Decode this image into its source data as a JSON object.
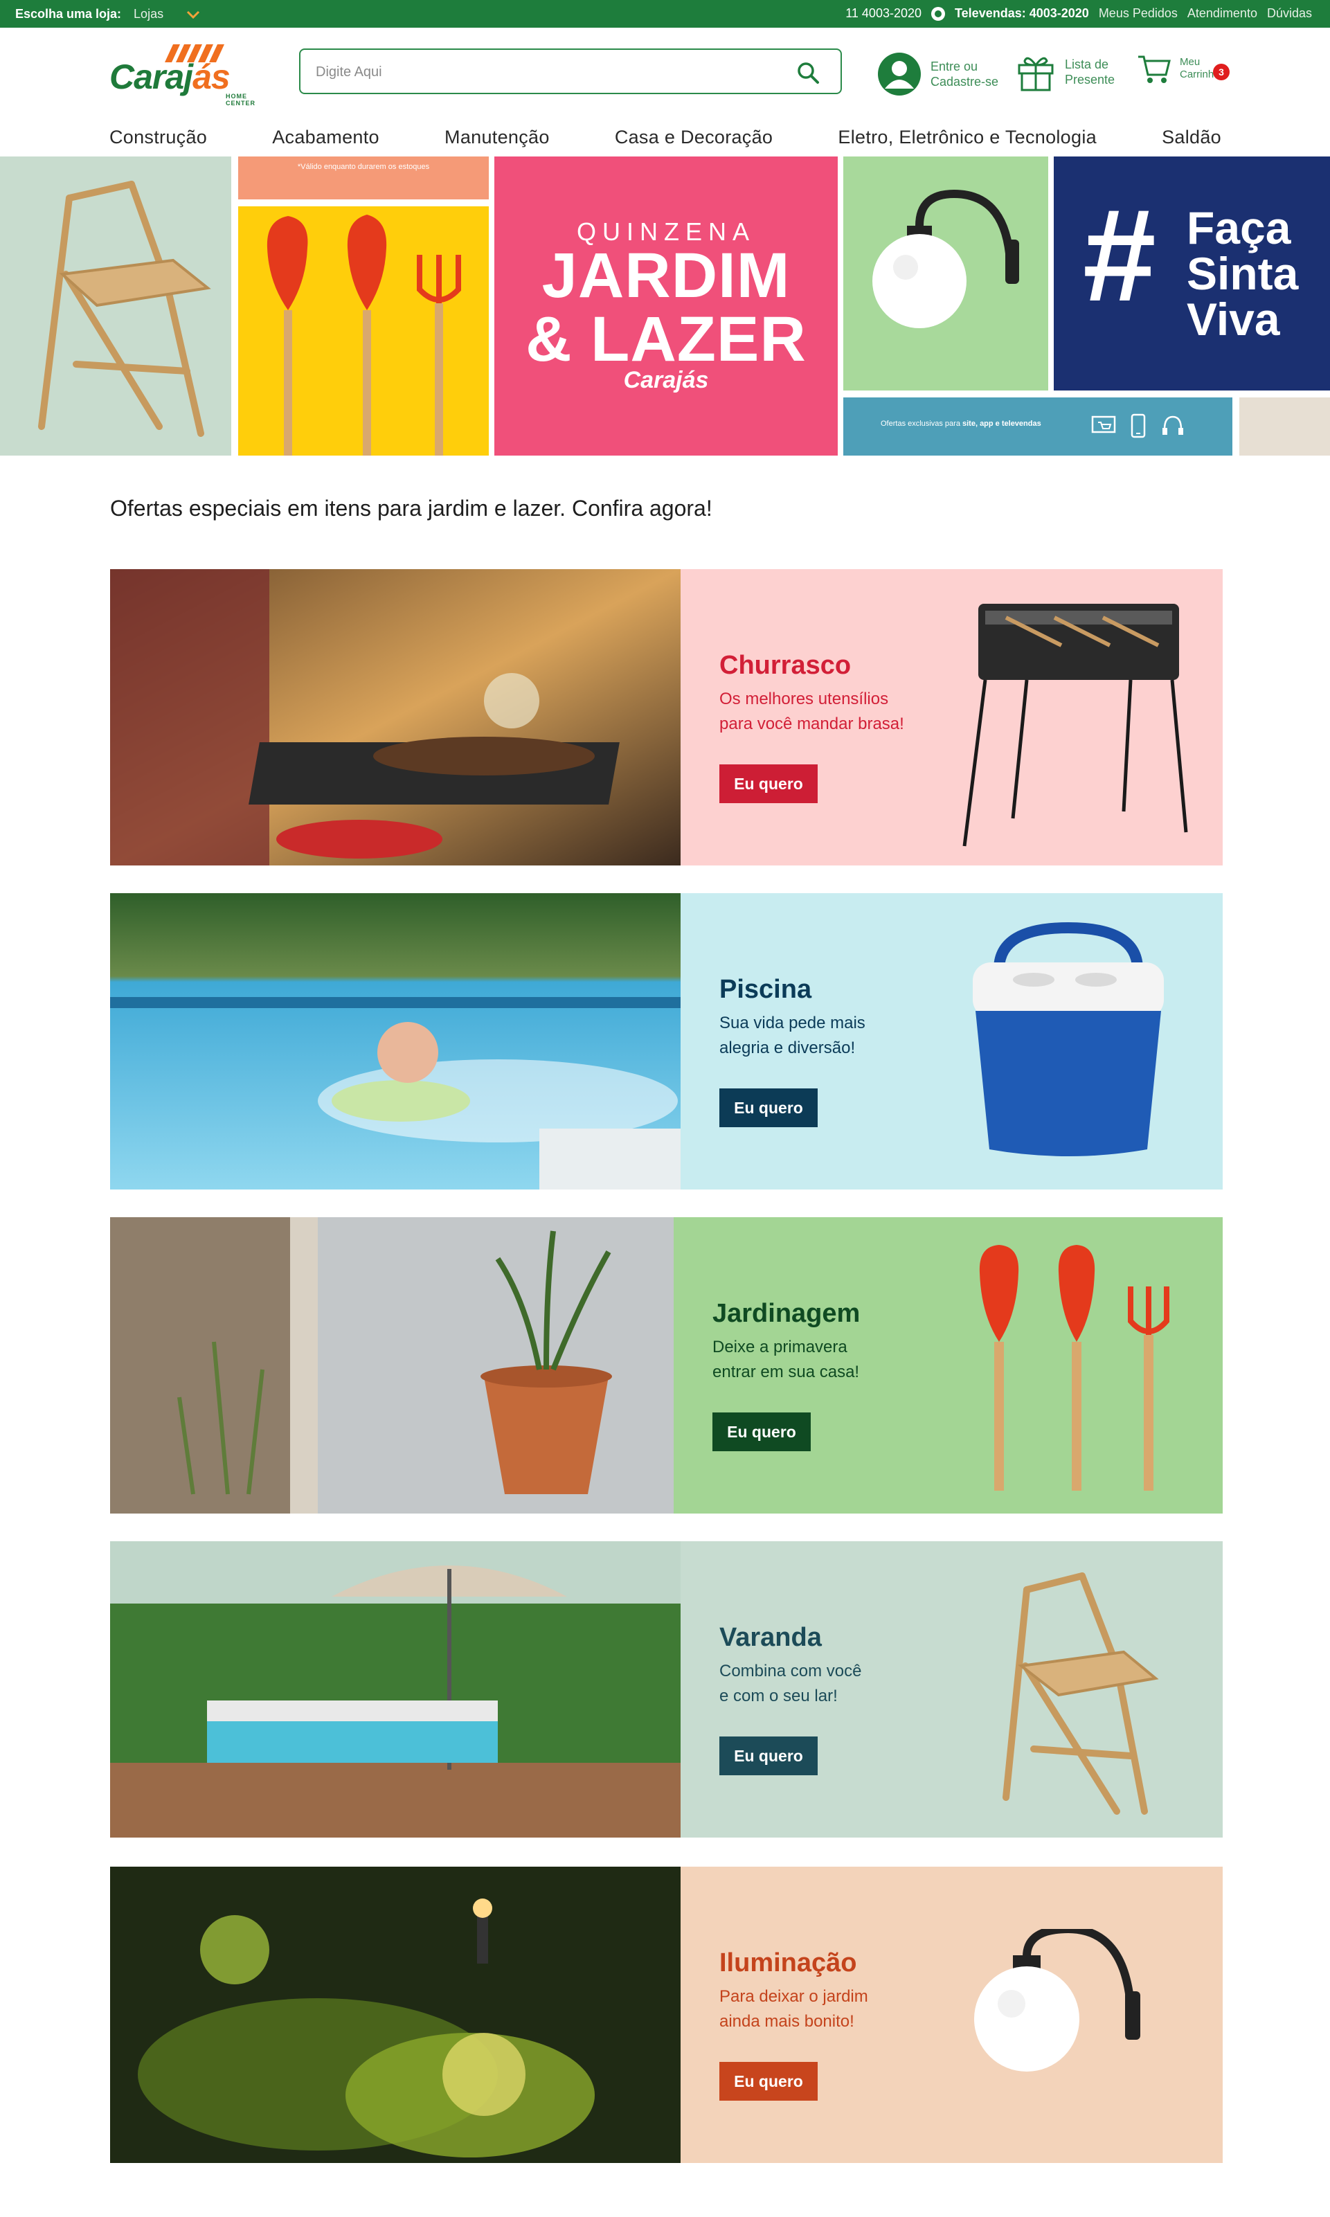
{
  "topbar": {
    "store_label": "Escolha uma loja:",
    "store_value": "Lojas",
    "phone": "11 4003-2020",
    "televendas": "Televendas: 4003-2020",
    "links": [
      "Meus Pedidos",
      "Atendimento",
      "Dúvidas"
    ]
  },
  "logo": {
    "brand_main": "Caraj",
    "brand_accent": "ás",
    "tagline": "HOME CENTER"
  },
  "search": {
    "placeholder": "Digite Aqui"
  },
  "header": {
    "account": {
      "line1": "Entre ou",
      "line2": "Cadastre-se"
    },
    "gift": {
      "line1": "Lista de",
      "line2": "Presente"
    },
    "cart": {
      "line1": "Meu",
      "line2": "Carrinho",
      "count": "3"
    }
  },
  "nav": [
    "Construção",
    "Acabamento",
    "Manutenção",
    "Casa e Decoração",
    "Eletro, Eletrônico e Tecnologia",
    "Saldão"
  ],
  "hero": {
    "note": "*Válido enquanto durarem os estoques",
    "quinzena_small": "QUINZENA",
    "quinzena_line1": "JARDIM",
    "quinzena_line2": "& LAZER",
    "quinzena_brand": "Carajás",
    "faca": {
      "hash": "#",
      "line1": "Faça",
      "line2": "Sinta",
      "line3": "Viva"
    },
    "ofertas_prefix": "Ofertas exclusivas para ",
    "ofertas_bold": "site, app e televendas"
  },
  "intro": "Ofertas especiais em itens para jardim e lazer. Confira agora!",
  "banners": [
    {
      "title": "Churrasco",
      "desc1": "Os melhores utensílios",
      "desc2": "para você mandar brasa!",
      "cta": "Eu quero"
    },
    {
      "title": "Piscina",
      "desc1": "Sua vida pede mais",
      "desc2": "alegria e diversão!",
      "cta": "Eu quero"
    },
    {
      "title": "Jardinagem",
      "desc1": "Deixe a primavera",
      "desc2": "entrar em sua casa!",
      "cta": "Eu quero"
    },
    {
      "title": "Varanda",
      "desc1": "Combina com você",
      "desc2": "e com o seu lar!",
      "cta": "Eu quero"
    },
    {
      "title": "Iluminação",
      "desc1": "Para deixar o jardim",
      "desc2": "ainda mais bonito!",
      "cta": "Eu quero"
    }
  ],
  "colors": {
    "brand_green": "#1e7d3c",
    "brand_orange": "#f06f1f",
    "churrasco": "#cd1e35",
    "piscina": "#0c3b56",
    "jardinagem": "#0f4a22",
    "varanda": "#1c4b58",
    "iluminacao": "#c8451d"
  },
  "icons": [
    "chevron-down-icon",
    "whatsapp-icon",
    "search-icon",
    "user-icon",
    "gift-icon",
    "cart-icon"
  ]
}
